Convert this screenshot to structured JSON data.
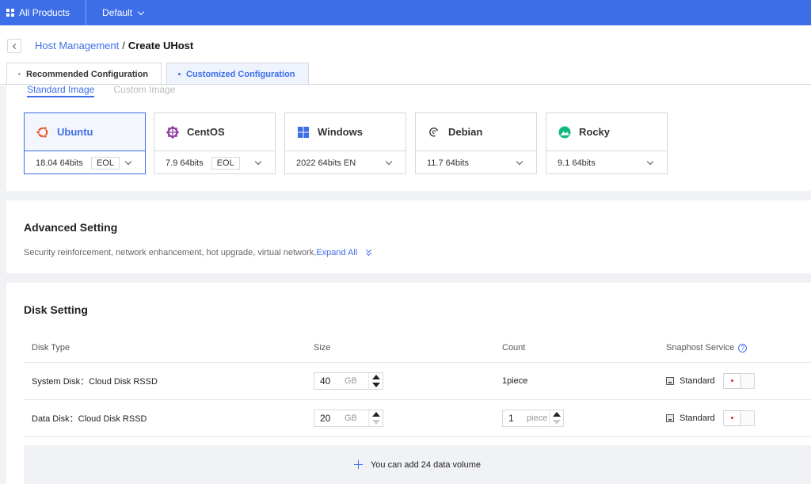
{
  "topbar": {
    "products_label": "All Products",
    "project_label": "Default"
  },
  "breadcrumb": {
    "parent": "Host Management",
    "separator": "/",
    "current": "Create UHost"
  },
  "config_tabs": [
    {
      "label": "Recommended Configuration",
      "active": false
    },
    {
      "label": "Customized Configuration",
      "active": true
    }
  ],
  "image_tabs": [
    {
      "label": "Standard Image",
      "active": true
    },
    {
      "label": "Custom Image",
      "active": false
    }
  ],
  "os_options": [
    {
      "name": "Ubuntu",
      "version": "18.04 64bits",
      "badge": "EOL",
      "selected": true,
      "icon": "ubuntu-icon",
      "color": "#e95420"
    },
    {
      "name": "CentOS",
      "version": "7.9 64bits",
      "badge": "EOL",
      "selected": false,
      "icon": "centos-icon",
      "color": "#8f3a9e"
    },
    {
      "name": "Windows",
      "version": "2022 64bits EN",
      "badge": "",
      "selected": false,
      "icon": "windows-icon",
      "color": "#3d6ee8"
    },
    {
      "name": "Debian",
      "version": "11.7 64bits",
      "badge": "",
      "selected": false,
      "icon": "debian-icon",
      "color": "#444444"
    },
    {
      "name": "Rocky",
      "version": "9.1 64bits",
      "badge": "",
      "selected": false,
      "icon": "rocky-icon",
      "color": "#10b981"
    }
  ],
  "advanced": {
    "title": "Advanced Setting",
    "description": "Security reinforcement, network enhancement, hot upgrade, virtual network,",
    "expand_label": "Expand All"
  },
  "disk": {
    "title": "Disk Setting",
    "headers": {
      "type": "Disk Type",
      "size": "Size",
      "count": "Count",
      "snapshot": "Snaphost Service"
    },
    "rows": [
      {
        "type": "System Disk：Cloud Disk RSSD",
        "size": "40",
        "unit": "GB",
        "count_text": "1piece",
        "snapshot": "Standard"
      },
      {
        "type": "Data Disk：Cloud Disk RSSD",
        "size": "20",
        "unit": "GB",
        "count_value": "1",
        "count_unit": "piece",
        "snapshot": "Standard"
      }
    ],
    "add_label": "You can add 24 data volume"
  },
  "colors": {
    "accent": "#3d6ee8",
    "topbar": "#3d6ee8"
  }
}
